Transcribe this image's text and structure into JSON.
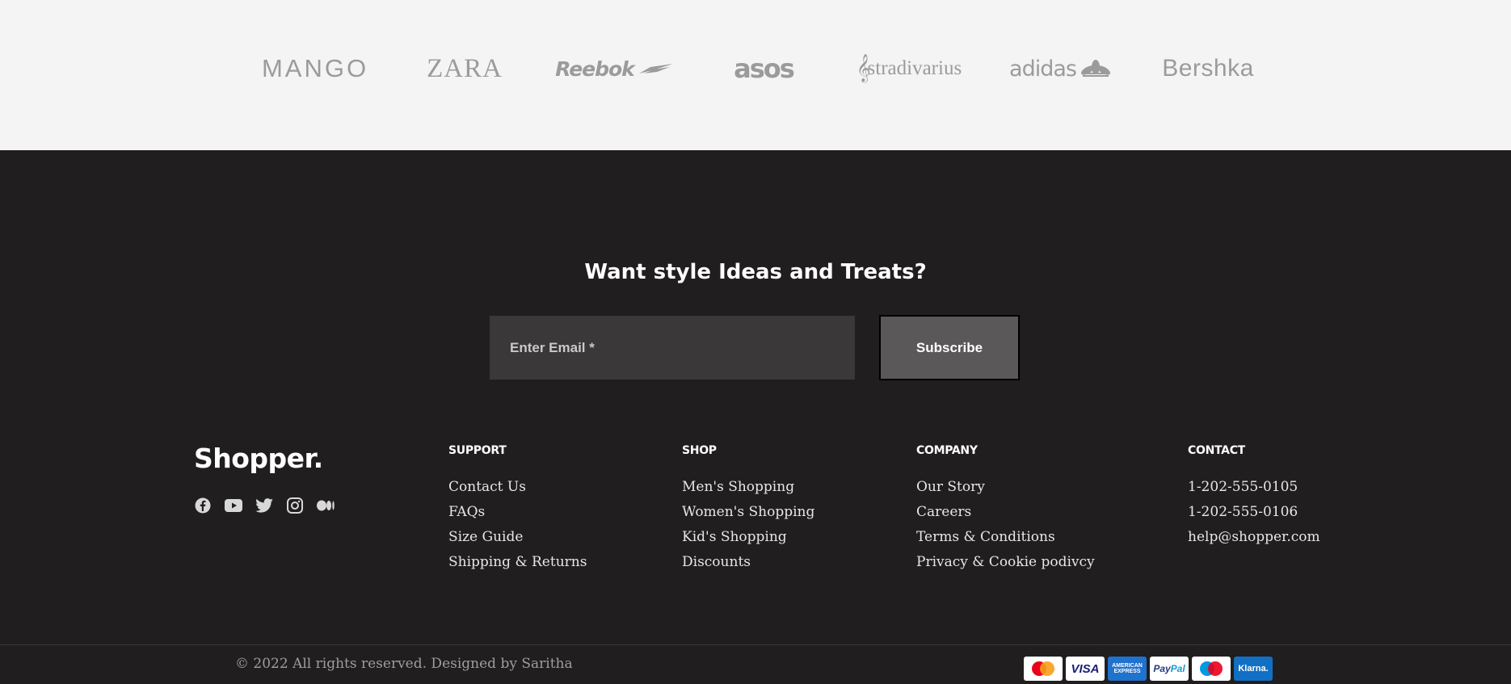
{
  "brands": {
    "mango": "MANGO",
    "zara": "ZARA",
    "reebok": "Reebok",
    "asos": "asos",
    "stradivarius": "stradivarius",
    "adidas": "adidas",
    "bershka": "Bershka"
  },
  "newsletter": {
    "title": "Want style Ideas and Treats?",
    "email_placeholder": "Enter Email *",
    "subscribe_label": "Subscribe"
  },
  "footer": {
    "logo": "Shopper.",
    "socials": [
      "facebook-icon",
      "youtube-icon",
      "twitter-icon",
      "instagram-icon",
      "medium-icon"
    ],
    "support": {
      "title": "SUPPORT",
      "links": [
        "Contact Us",
        "FAQs",
        "Size Guide",
        "Shipping & Returns"
      ]
    },
    "shop": {
      "title": "SHOP",
      "links": [
        "Men's Shopping",
        "Women's Shopping",
        "Kid's Shopping",
        "Discounts"
      ]
    },
    "company": {
      "title": "COMPANY",
      "links": [
        "Our Story",
        "Careers",
        "Terms & Conditions",
        "Privacy & Cookie podivcy"
      ]
    },
    "contact": {
      "title": "CONTACT",
      "links": [
        "1-202-555-0105",
        "1-202-555-0106",
        "help@shopper.com"
      ]
    },
    "copyright": "© 2022 All rights reserved. Designed by Saritha",
    "payments": {
      "visa": "VISA",
      "amex": "AMERICAN EXPRESS",
      "paypal_a": "Pay",
      "paypal_b": "Pal",
      "klarna": "Klarna."
    }
  },
  "colors": {
    "footer_bg": "#201e1f",
    "brands_bg": "#f4f4f4",
    "input_bg": "#3a3839",
    "button_bg": "#5a5859"
  }
}
